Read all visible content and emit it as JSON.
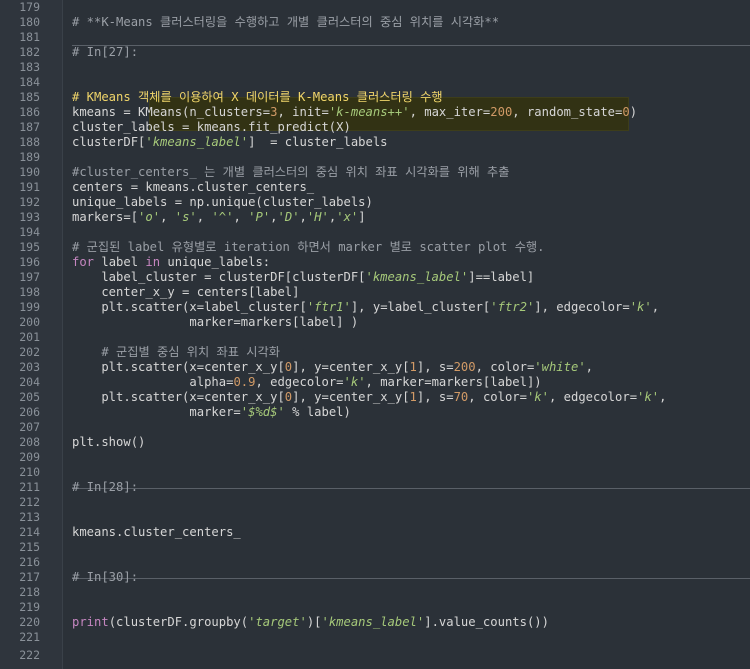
{
  "editor": {
    "line_numbers": [
      "179",
      "180",
      "181",
      "182",
      "183",
      "184",
      "185",
      "186",
      "187",
      "188",
      "189",
      "190",
      "191",
      "192",
      "193",
      "194",
      "195",
      "196",
      "197",
      "198",
      "199",
      "200",
      "201",
      "202",
      "203",
      "204",
      "205",
      "206",
      "207",
      "208",
      "209",
      "210",
      "211",
      "212",
      "213",
      "214",
      "215",
      "216",
      "217",
      "218",
      "219",
      "220",
      "221",
      "222"
    ],
    "lines": {
      "l180": "# **K-Means 클러스터링을 수행하고 개별 클러스터의 중심 위치를 시각화**",
      "l182": "# In[27]:",
      "l185": "# KMeans 객체를 이용하여 X 데이터를 K-Means 클러스터링 수행",
      "l186a": "kmeans = KMeans(n_clusters=",
      "l186b": "3",
      "l186c": ", init=",
      "l186d": "'k-means++'",
      "l186e": ", max_iter=",
      "l186f": "200",
      "l186g": ", random_state=",
      "l186h": "0",
      "l186i": ")",
      "l187": "cluster_labels = kmeans.fit_predict(X)",
      "l188a": "clusterDF[",
      "l188b": "'kmeans_label'",
      "l188c": "]  = cluster_labels",
      "l190": "#cluster_centers_ 는 개별 클러스터의 중심 위치 좌표 시각화를 위해 추출",
      "l191": "centers = kmeans.cluster_centers_",
      "l192": "unique_labels = np.unique(cluster_labels)",
      "l193a": "markers=[",
      "l193b": "'o'",
      "l193c": ", ",
      "l193d": "'s'",
      "l193e": ", ",
      "l193f": "'^'",
      "l193g": ", ",
      "l193h": "'P'",
      "l193i": ",",
      "l193j": "'D'",
      "l193k": ",",
      "l193l": "'H'",
      "l193m": ",",
      "l193n": "'x'",
      "l193o": "]",
      "l195": "# 군집된 label 유형별로 iteration 하면서 marker 별로 scatter plot 수행.",
      "l196a": "for",
      "l196b": " label ",
      "l196c": "in",
      "l196d": " unique_labels:",
      "l197a": "    label_cluster = clusterDF[clusterDF[",
      "l197b": "'kmeans_label'",
      "l197c": "]==label]",
      "l198": "    center_x_y = centers[label]",
      "l199a": "    plt.scatter(x=label_cluster[",
      "l199b": "'ftr1'",
      "l199c": "], y=label_cluster[",
      "l199d": "'ftr2'",
      "l199e": "], edgecolor=",
      "l199f": "'k'",
      "l199g": ",",
      "l200": "                marker=markers[label] )",
      "l202": "    # 군집별 중심 위치 좌표 시각화",
      "l203a": "    plt.scatter(x=center_x_y[",
      "l203b": "0",
      "l203c": "], y=center_x_y[",
      "l203d": "1",
      "l203e": "], s=",
      "l203f": "200",
      "l203g": ", color=",
      "l203h": "'white'",
      "l203i": ",",
      "l204a": "                alpha=",
      "l204b": "0.9",
      "l204c": ", edgecolor=",
      "l204d": "'k'",
      "l204e": ", marker=markers[label])",
      "l205a": "    plt.scatter(x=center_x_y[",
      "l205b": "0",
      "l205c": "], y=center_x_y[",
      "l205d": "1",
      "l205e": "], s=",
      "l205f": "70",
      "l205g": ", color=",
      "l205h": "'k'",
      "l205i": ", edgecolor=",
      "l205j": "'k'",
      "l205k": ",",
      "l206a": "                marker=",
      "l206b": "'$%d$'",
      "l206c": " % label)",
      "l208": "plt.show()",
      "l211": "# In[28]:",
      "l214": "kmeans.cluster_centers_",
      "l217": "# In[30]:",
      "l220a": "print",
      "l220b": "(clusterDF.groupby(",
      "l220c": "'target'",
      "l220d": ")[",
      "l220e": "'kmeans_label'",
      "l220f": "].value_counts())"
    }
  },
  "colors": {
    "background": "#2b3138",
    "gutter": "#2f353d",
    "comment": "#9a9fa6",
    "keyword": "#c586c0",
    "string": "#a6c97a",
    "number": "#d19a66",
    "selection": "#323214"
  }
}
